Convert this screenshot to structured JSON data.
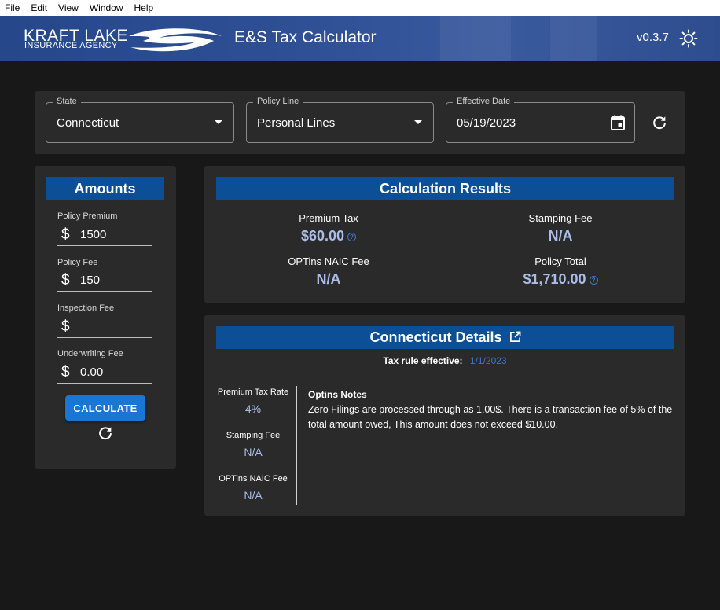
{
  "menu": [
    "File",
    "Edit",
    "View",
    "Window",
    "Help"
  ],
  "header": {
    "logo_main": "KRAFT LAKE",
    "logo_sub": "INSURANCE AGENCY",
    "title": "E&S Tax Calculator",
    "version": "v0.3.7",
    "theme_icon": "sun-icon"
  },
  "filters": {
    "state": {
      "label": "State",
      "value": "Connecticut"
    },
    "policy_line": {
      "label": "Policy Line",
      "value": "Personal Lines"
    },
    "effective_date": {
      "label": "Effective Date",
      "value": "05/19/2023"
    }
  },
  "amounts": {
    "title": "Amounts",
    "currency": "$",
    "fields": [
      {
        "label": "Policy Premium",
        "value": "1500"
      },
      {
        "label": "Policy Fee",
        "value": "150"
      },
      {
        "label": "Inspection Fee",
        "value": ""
      },
      {
        "label": "Underwriting Fee",
        "value": "0.00"
      }
    ],
    "calculate_label": "CALCULATE"
  },
  "results": {
    "title": "Calculation Results",
    "premium_tax": {
      "label": "Premium Tax",
      "value": "$60.00"
    },
    "stamping_fee": {
      "label": "Stamping Fee",
      "value": "N/A"
    },
    "naic_fee": {
      "label": "OPTins NAIC Fee",
      "value": "N/A"
    },
    "policy_total": {
      "label": "Policy Total",
      "value": "$1,710.00"
    }
  },
  "details": {
    "title": "Connecticut Details",
    "rule_label": "Tax rule effective:",
    "rule_date": "1/1/2023",
    "premium_tax_rate": {
      "label": "Premium Tax Rate",
      "value": "4%"
    },
    "stamping_fee": {
      "label": "Stamping Fee",
      "value": "N/A"
    },
    "naic_fee": {
      "label": "OPTins NAIC Fee",
      "value": "N/A"
    },
    "notes_title": "Optins Notes",
    "notes_text": "Zero Filings are processed through as 1.00$. There is a transaction fee of 5% of the total amount owed, This amount does not exceed $10.00."
  },
  "colors": {
    "header_blue": "#2f4f95",
    "banner_blue": "#0d4f96",
    "button_blue": "#1976d2",
    "value_blue": "#a9bde6",
    "link_blue": "#3a78c8"
  }
}
